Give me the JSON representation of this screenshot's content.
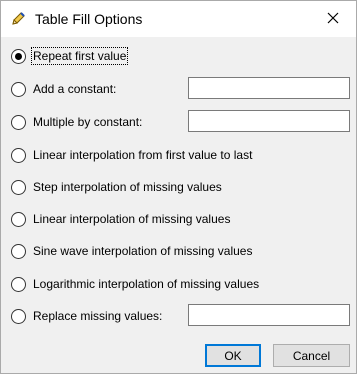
{
  "window": {
    "title": "Table Fill Options",
    "icon": "pencil-icon",
    "close_icon": "close-icon"
  },
  "options": [
    {
      "label": "Repeat first value",
      "selected": true
    },
    {
      "label": "Add a constant:",
      "selected": false,
      "input_value": ""
    },
    {
      "label": "Multiple by constant:",
      "selected": false,
      "input_value": ""
    },
    {
      "label": "Linear interpolation from first value to last",
      "selected": false
    },
    {
      "label": "Step interpolation of missing values",
      "selected": false
    },
    {
      "label": "Linear interpolation of missing values",
      "selected": false
    },
    {
      "label": "Sine wave interpolation of missing values",
      "selected": false
    },
    {
      "label": "Logarithmic interpolation of missing values",
      "selected": false
    },
    {
      "label": "Replace missing values:",
      "selected": false,
      "input_value": ""
    }
  ],
  "buttons": {
    "ok_label": "OK",
    "cancel_label": "Cancel"
  },
  "colors": {
    "accent": "#0078d7",
    "dialog_background": "#f0f0f0",
    "titlebar_background": "#ffffff"
  }
}
